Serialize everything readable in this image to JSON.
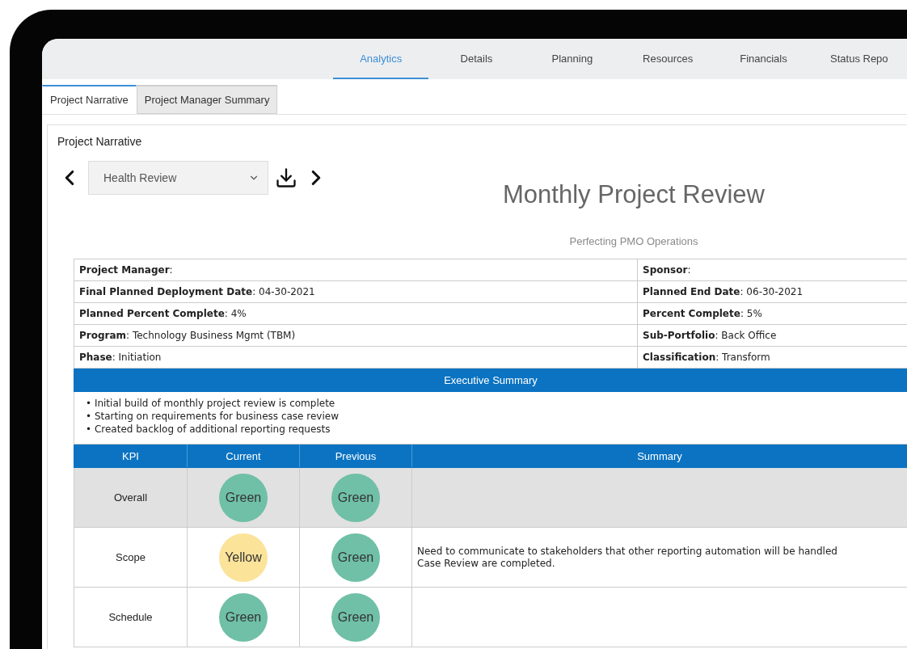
{
  "nav_tabs": [
    {
      "label": "Analytics",
      "selected": true
    },
    {
      "label": "Details",
      "selected": false
    },
    {
      "label": "Planning",
      "selected": false
    },
    {
      "label": "Resources",
      "selected": false
    },
    {
      "label": "Financials",
      "selected": false
    },
    {
      "label": "Status Repo",
      "selected": false
    }
  ],
  "sub_tabs": [
    {
      "label": "Project Narrative",
      "selected": true
    },
    {
      "label": "Project Manager Summary",
      "selected": false
    }
  ],
  "panel": {
    "title": "Project Narrative",
    "report_select": {
      "value": "Health Review"
    }
  },
  "report": {
    "title": "Monthly Project Review",
    "subtitle": "Perfecting PMO Operations",
    "info_rows": [
      [
        "**Project Manager**:",
        "**Sponsor**:"
      ],
      [
        "**Final Planned Deployment Date**: 04-30-2021",
        "**Planned End Date**: 06-30-2021"
      ],
      [
        "**Planned Percent Complete**: 4%",
        "**Percent Complete**: 5%"
      ],
      [
        "**Program**: Technology Business Mgmt (TBM)",
        "**Sub-Portfolio**: Back Office"
      ],
      [
        "**Phase**: Initiation",
        "**Classification**: Transform"
      ]
    ],
    "executive_summary": {
      "heading": "Executive Summary",
      "bullets": [
        "• Initial build of monthly project review is complete",
        "• Starting on requirements for business case review",
        "• Created backlog of additional reporting requests"
      ]
    },
    "kpi_table": {
      "columns": [
        "KPI",
        "Current",
        "Previous",
        "Summary"
      ],
      "rows": [
        {
          "kpi": "Overall",
          "highlighted": true,
          "current": {
            "label": "Green",
            "color": "#6fc0a6"
          },
          "previous": {
            "label": "Green",
            "color": "#6fc0a6"
          }
        },
        {
          "kpi": "Scope",
          "highlighted": false,
          "current": {
            "label": "Yellow",
            "color": "#fbe39a"
          },
          "previous": {
            "label": "Green",
            "color": "#6fc0a6"
          },
          "summary_lines": [
            "Need to communicate to stakeholders that other reporting automation will be handled",
            "Case Review are completed."
          ]
        },
        {
          "kpi": "Schedule",
          "highlighted": false,
          "current": {
            "label": "Green",
            "color": "#6fc0a6"
          },
          "previous": {
            "label": "Green",
            "color": "#6fc0a6"
          }
        }
      ]
    }
  }
}
